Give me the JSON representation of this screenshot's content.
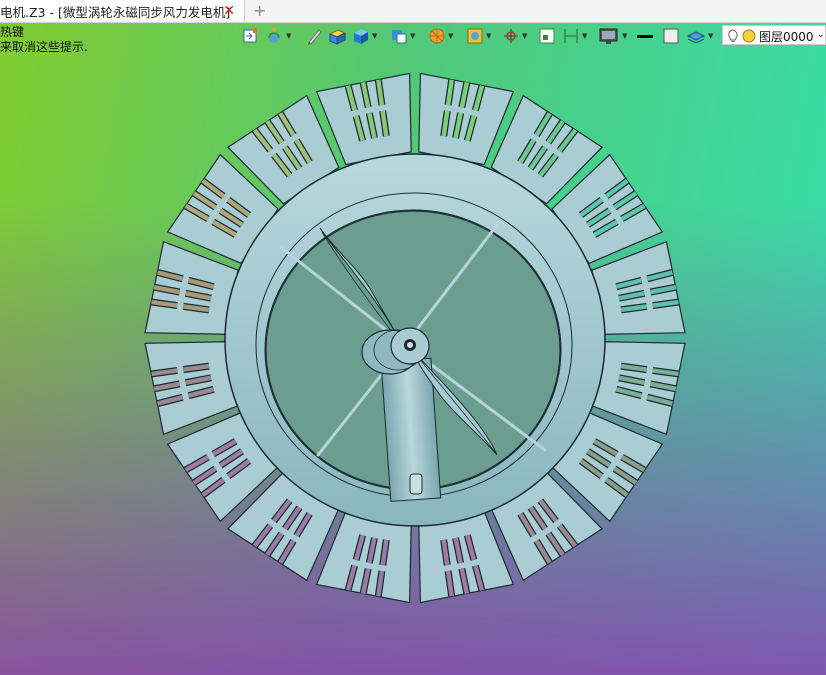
{
  "tab": {
    "title": "电机.Z3 - [微型涡轮永磁同步风力发电机]",
    "close_symbol": "✕",
    "add_symbol": "+"
  },
  "hint": {
    "line1": "热键",
    "line2": "来取消这些提示."
  },
  "layer_dropdown": {
    "value": "图层0000",
    "arrow": "⌄"
  },
  "colors": {
    "blade_face": "#a9cdd3",
    "ring": "#9fc8d0",
    "hub": "#8fb8c0",
    "outline": "#1a2a30"
  }
}
